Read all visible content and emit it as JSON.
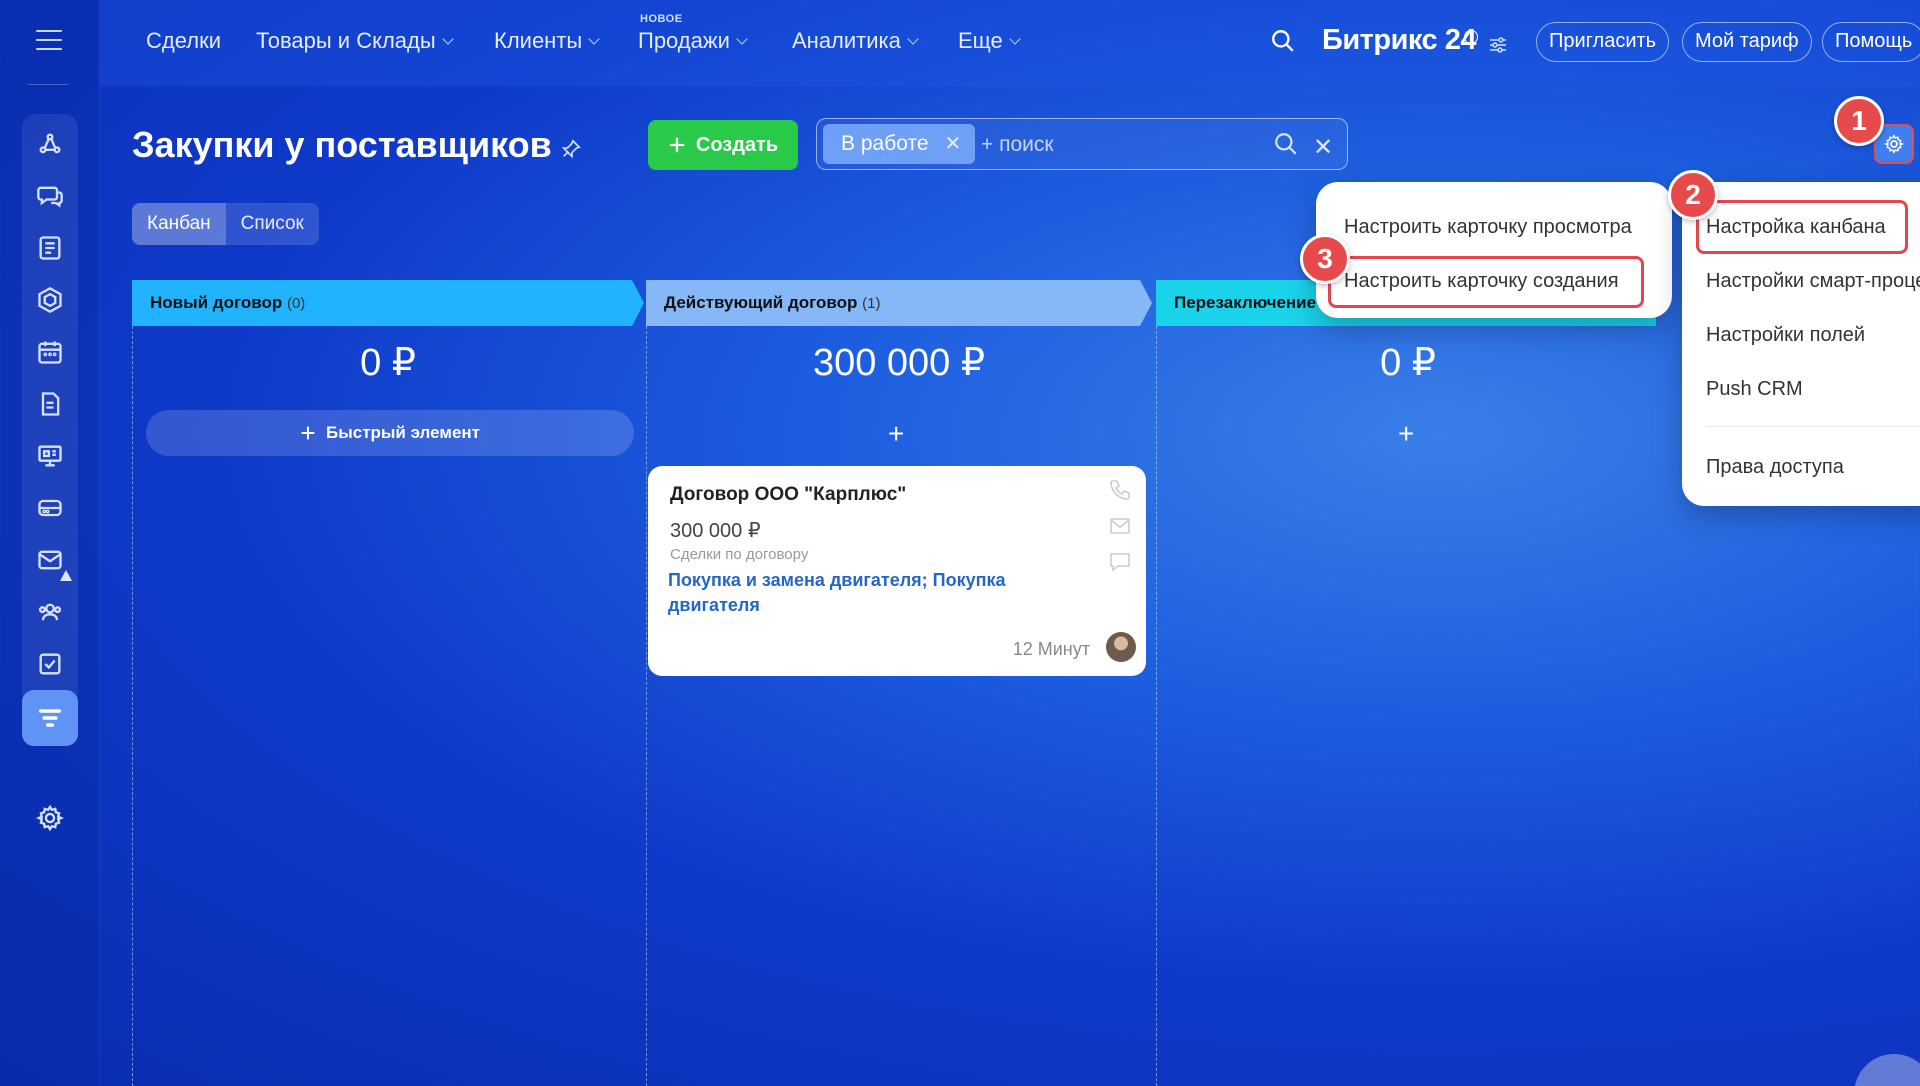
{
  "nav": {
    "items": [
      {
        "label": "Сделки",
        "chevron": false
      },
      {
        "label": "Товары и Склады",
        "chevron": true
      },
      {
        "label": "Клиенты",
        "chevron": true
      },
      {
        "label": "Продажи",
        "chevron": true
      },
      {
        "label": "Аналитика",
        "chevron": true
      },
      {
        "label": "Еще",
        "chevron": true
      }
    ],
    "badge_new": "НОВОЕ",
    "brand": "Битрикс 24",
    "invite": "Пригласить",
    "tariff": "Мой тариф",
    "help": "Помощь"
  },
  "toolbar": {
    "title": "Закупки у поставщиков",
    "create": "Создать",
    "filter_chip": "В работе",
    "filter_placeholder": "+ поиск"
  },
  "view_switch": {
    "kanban": "Канбан",
    "list": "Список"
  },
  "columns": [
    {
      "title": "Новый договор",
      "count": "(0)",
      "sum": "0 ₽",
      "color": "#22b3ff"
    },
    {
      "title": "Действующий договор",
      "count": "(1)",
      "sum": "300 000 ₽",
      "color": "#86b8f7"
    },
    {
      "title": "Перезаключение",
      "count": "",
      "sum": "0 ₽",
      "color": "#1ad3ea"
    }
  ],
  "quick_add": "Быстрый элемент",
  "card": {
    "title": "Договор ООО \"Карплюс\"",
    "sum": "300 000 ₽",
    "label": "Сделки по договору",
    "link": "Покупка и замена двигателя; Покупка двигателя",
    "time": "12 Минут"
  },
  "menu_card": {
    "items": [
      "Настроить карточку просмотра",
      "Настроить карточку создания"
    ]
  },
  "menu_settings": {
    "items": [
      "Настройка канбана",
      "Настройки смарт-процесса",
      "Настройки полей",
      "Push CRM",
      "Права доступа"
    ]
  },
  "callouts": [
    "1",
    "2",
    "3"
  ],
  "colors": {
    "accent_green": "#29c94a",
    "highlight_red": "#e3464c",
    "link_blue": "#2467c9"
  }
}
